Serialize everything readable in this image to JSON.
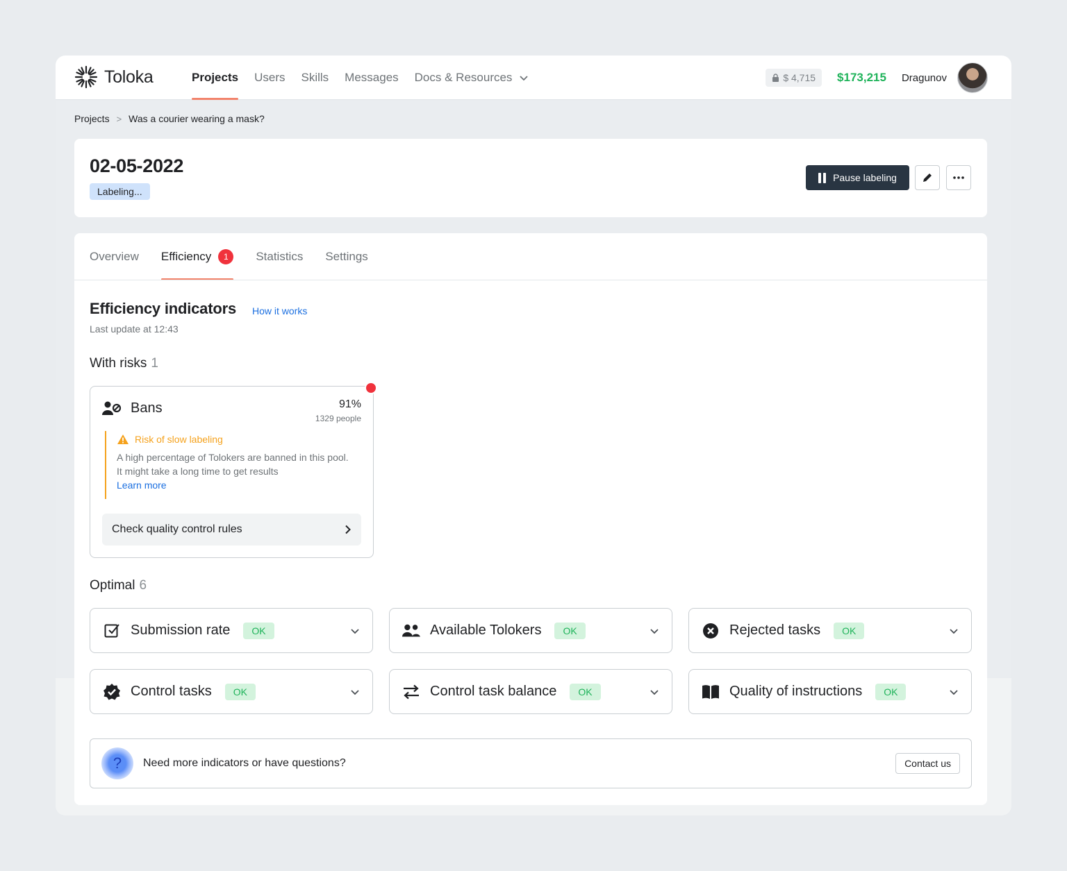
{
  "app": {
    "name": "Toloka"
  },
  "nav": {
    "items": [
      {
        "label": "Projects"
      },
      {
        "label": "Users"
      },
      {
        "label": "Skills"
      },
      {
        "label": "Messages"
      },
      {
        "label": "Docs & Resources"
      }
    ]
  },
  "account": {
    "locked_balance": "$ 4,715",
    "balance": "$173,215",
    "username": "Dragunov"
  },
  "breadcrumb": {
    "root": "Projects",
    "separator": ">",
    "current": "Was a courier wearing a mask?"
  },
  "pool": {
    "title": "02-05-2022",
    "status": "Labeling...",
    "pause_label": "Pause labeling"
  },
  "tabs": [
    {
      "label": "Overview"
    },
    {
      "label": "Efficiency",
      "badge": "1"
    },
    {
      "label": "Statistics"
    },
    {
      "label": "Settings"
    }
  ],
  "efficiency": {
    "title": "Efficiency indicators",
    "how_link": "How it works",
    "updated": "Last update at 12:43"
  },
  "risks": {
    "label": "With risks",
    "count": "1",
    "card": {
      "name": "Bans",
      "percent": "91%",
      "people": "1329 people",
      "alert_title": "Risk of slow labeling",
      "alert_line1": "A high percentage of Tolokers are banned in this pool.",
      "alert_line2": "It might take a long time to get results",
      "learn_more": "Learn more",
      "action": "Check quality control rules"
    }
  },
  "optimal": {
    "label": "Optimal",
    "count": "6",
    "items": [
      {
        "label": "Submission rate",
        "status": "OK",
        "icon": "checkbox-icon"
      },
      {
        "label": "Available Tolokers",
        "status": "OK",
        "icon": "users-icon"
      },
      {
        "label": "Rejected tasks",
        "status": "OK",
        "icon": "x-circle-icon"
      },
      {
        "label": "Control tasks",
        "status": "OK",
        "icon": "verified-badge-icon"
      },
      {
        "label": "Control task balance",
        "status": "OK",
        "icon": "swap-arrows-icon"
      },
      {
        "label": "Quality of instructions",
        "status": "OK",
        "icon": "book-icon"
      }
    ]
  },
  "help": {
    "text": "Need more indicators or have questions?",
    "button": "Contact us",
    "icon_glyph": "?"
  },
  "colors": {
    "accent": "#f2836b",
    "ok_text": "#1fb35a",
    "ok_bg": "#d3f3dd",
    "warning": "#f5a21d",
    "danger": "#f0323c",
    "link": "#1b6fe0",
    "primary_button": "#293542"
  }
}
